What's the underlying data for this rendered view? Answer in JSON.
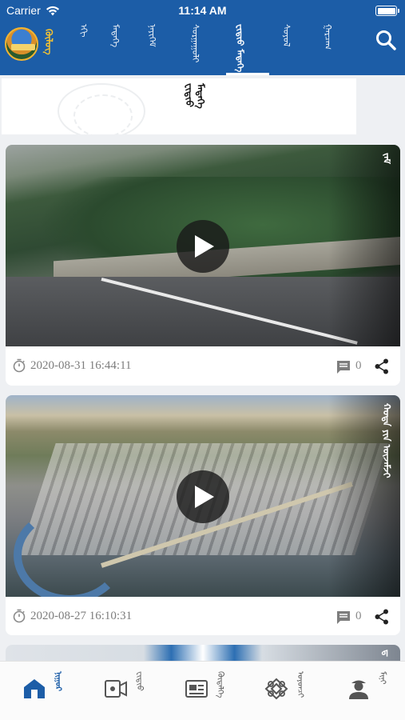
{
  "status_bar": {
    "carrier": "Carrier",
    "time": "11:14 AM"
  },
  "header": {
    "brand": "ᠬᠥᠯᠥᠭ",
    "tabs": [
      {
        "label": "ᠡᠬᠢ"
      },
      {
        "label": "ᠮᠡᠳᠡᠭᠡ"
      },
      {
        "label": "ᠨᠡᠶᠢᠭᠡᠮ"
      },
      {
        "label": "ᠰᠤᠷᠭᠠᠭᠤᠯᠢ"
      },
      {
        "label": "ᠸᠢᠳᠢᠣ ᠮᠡᠳᠡᠭᠡ"
      },
      {
        "label": "ᠰᠤᠶᠤᠯ"
      },
      {
        "label": "ᠭᠠᠷᠴᠠᠭ"
      }
    ],
    "active_tab": 4
  },
  "banner": {
    "title": "ᠸᠢᠳᠢᠣ ᠮᠡᠳᠡᠭᠡ"
  },
  "videos": [
    {
      "tag": "ᠵᠠᠮ",
      "timestamp": "2020-08-31 16:44:11",
      "comments": "0"
    },
    {
      "tag": "ᠬᠣᠲᠠ ᠶᠢᠨ ᠦᠵᠡᠮᠵᠢ",
      "timestamp": "2020-08-27 16:10:31",
      "comments": "0"
    }
  ],
  "partial_card": {
    "tag": "ᠳ"
  },
  "tabbar": {
    "tabs": [
      {
        "label": "ᠨᠢᠭᠤᠷ",
        "icon": "home-icon"
      },
      {
        "label": "ᠸᠢᠳᠢᠣ",
        "icon": "video-icon"
      },
      {
        "label": "ᠬᠥᠳᠡᠯᠭᠡ",
        "icon": "id-card-icon"
      },
      {
        "label": "ᠣᠶᠣᠨᠴᠢ",
        "icon": "knot-icon"
      },
      {
        "label": "ᠮᠢᠨᠢ",
        "icon": "user-icon"
      }
    ],
    "active_tab": 0
  },
  "colors": {
    "header_bg": "#1c5da7",
    "active_icon": "#1c5da7",
    "inactive_icon": "#555555"
  }
}
